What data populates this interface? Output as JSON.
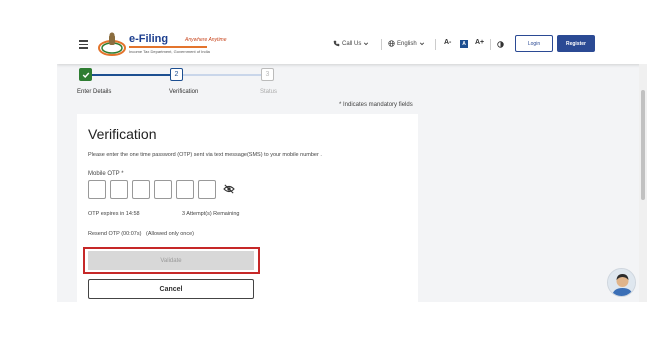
{
  "header": {
    "logo": {
      "title": "e-Filing",
      "tagline": "Anywhere Anytime",
      "subtitle": "Income Tax Department, Government of India"
    },
    "call_us": "Call Us",
    "language": "English",
    "font_sizes": [
      "A-",
      "A",
      "A+"
    ],
    "login_label": "Login",
    "register_label": "Register"
  },
  "stepper": {
    "steps": [
      {
        "number": "✔",
        "label": "Enter Details",
        "state": "done"
      },
      {
        "number": "2",
        "label": "Verification",
        "state": "active"
      },
      {
        "number": "3",
        "label": "Status",
        "state": "pending"
      }
    ]
  },
  "mandatory_note": "* Indicates mandatory fields",
  "verification": {
    "title": "Verification",
    "description": "Please enter the one time password (OTP) sent via text message(SMS) to your mobile number .",
    "otp_label": "Mobile OTP *",
    "otp_values": [
      "",
      "",
      "",
      "",
      "",
      ""
    ],
    "expires": "OTP expires in 14:58",
    "attempts": "3 Attempt(s) Remaining",
    "resend": "Resend OTP (00:07s)",
    "resend_note": "(Allowed only once)",
    "validate_label": "Validate",
    "cancel_label": "Cancel"
  },
  "colors": {
    "primary": "#2b4a94",
    "success": "#2e7d32",
    "highlight": "#c62828"
  }
}
